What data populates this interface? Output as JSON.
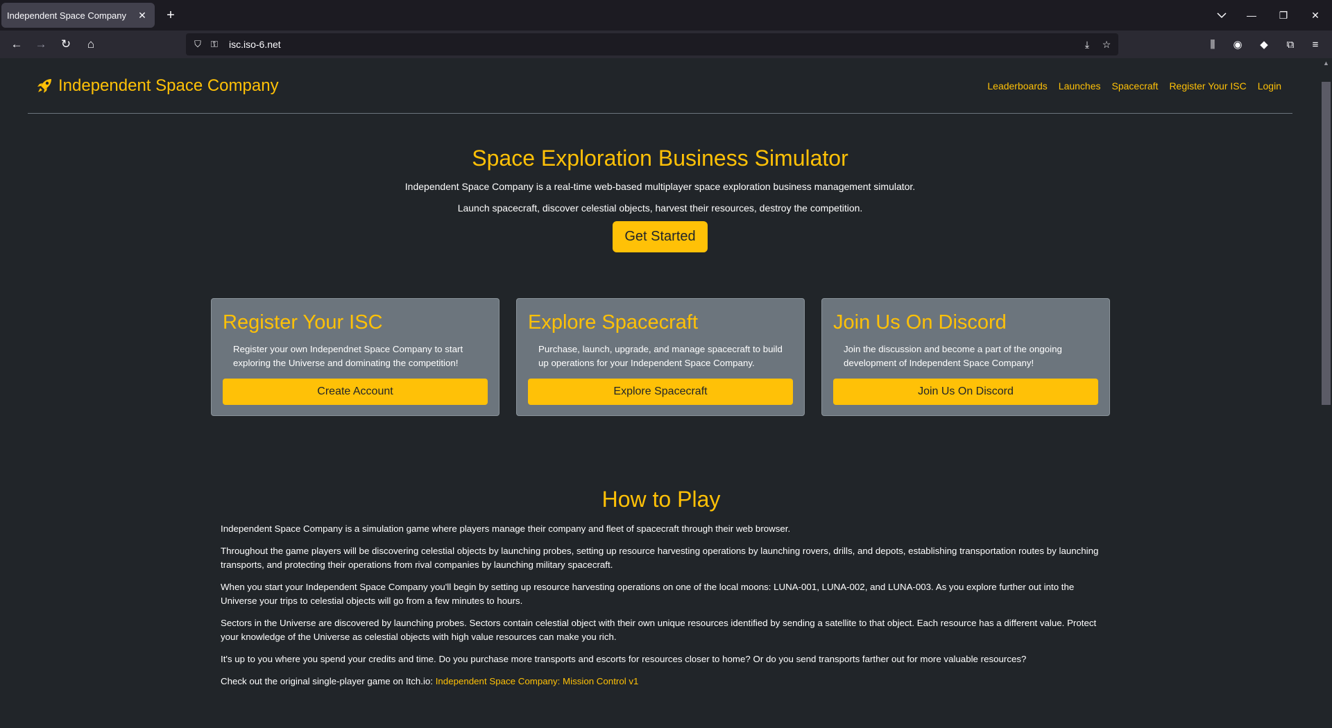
{
  "browser": {
    "tab_title": "Independent Space Company",
    "url": "isc.iso-6.net"
  },
  "site": {
    "brand": "Independent Space Company",
    "nav": [
      "Leaderboards",
      "Launches",
      "Spacecraft",
      "Register Your ISC",
      "Login"
    ]
  },
  "hero": {
    "title": "Space Exploration Business Simulator",
    "line1": "Independent Space Company is a real-time web-based multiplayer space exploration business management simulator.",
    "line2": "Launch spacecraft, discover celestial objects, harvest their resources, destroy the competition.",
    "cta": "Get Started"
  },
  "cards": [
    {
      "title": "Register Your ISC",
      "text": "Register your own Independnet Space Company to start exploring the Universe and dominating the competition!",
      "button": "Create Account"
    },
    {
      "title": "Explore Spacecraft",
      "text": "Purchase, launch, upgrade, and manage spacecraft to build up operations for your Independent Space Company.",
      "button": "Explore Spacecraft"
    },
    {
      "title": "Join Us On Discord",
      "text": "Join the discussion and become a part of the ongoing development of Independent Space Company!",
      "button": "Join Us On Discord"
    }
  ],
  "howto": {
    "title": "How to Play",
    "p1": "Independent Space Company is a simulation game where players manage their company and fleet of spacecraft through their web browser.",
    "p2": "Throughout the game players will be discovering celestial objects by launching probes, setting up resource harvesting operations by launching rovers, drills, and depots, establishing transportation routes by launching transports, and protecting their operations from rival companies by launching military spacecraft.",
    "p3": "When you start your Independent Space Company you'll begin by setting up resource harvesting operations on one of the local moons: LUNA-001, LUNA-002, and LUNA-003. As you explore further out into the Universe your trips to celestial objects will go from a few minutes to hours.",
    "p4": "Sectors in the Universe are discovered by launching probes. Sectors contain celestial object with their own unique resources identified by sending a satellite to that object. Each resource has a different value. Protect your knowledge of the Universe as celestial objects with high value resources can make you rich.",
    "p5": "It's up to you where you spend your credits and time. Do you purchase more transports and escorts for resources closer to home? Or do you send transports farther out for more valuable resources?",
    "p6_prefix": "Check out the original single-player game on Itch.io: ",
    "p6_link": "Independent Space Company: Mission Control v1"
  },
  "colors": {
    "accent": "#ffc107",
    "page_bg": "#212529",
    "card_bg": "#6c757d"
  }
}
